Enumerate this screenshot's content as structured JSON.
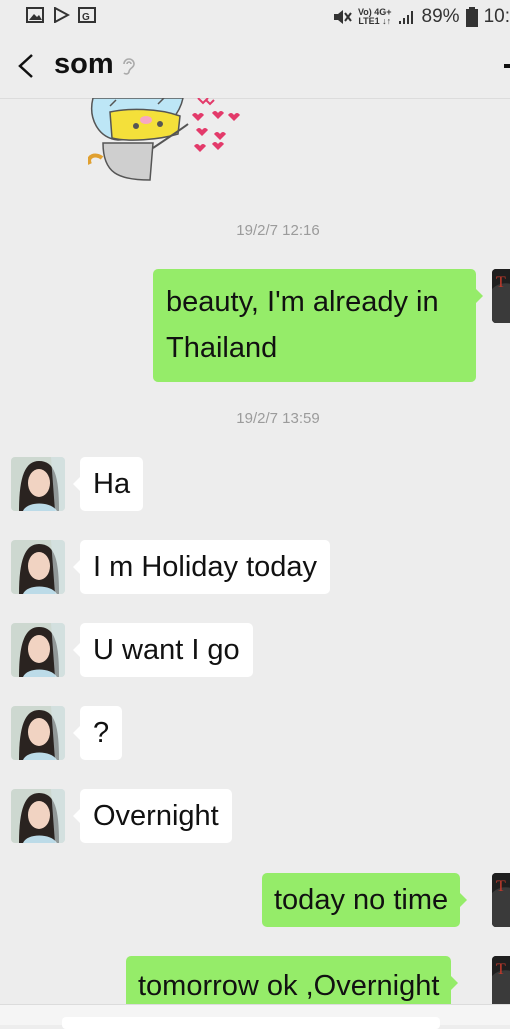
{
  "status_bar": {
    "network_label_top": "Vo) 4G+",
    "network_label_bottom": "LTE1 ↓↑",
    "battery": "89%",
    "clock": "10:"
  },
  "header": {
    "contact_name": "som",
    "icons": {
      "back": "chevron-left-icon",
      "mute": "ear-muted-icon",
      "more": "more-icon"
    }
  },
  "messages": [
    {
      "type": "sticker",
      "sender": "contact",
      "icon": "cat-sticker"
    },
    {
      "type": "time",
      "text": "19/2/7 12:16"
    },
    {
      "type": "text",
      "sender": "me",
      "lines": [
        "beauty, I'm already in",
        "Thailand"
      ]
    },
    {
      "type": "time",
      "text": "19/2/7 13:59"
    },
    {
      "type": "text",
      "sender": "contact",
      "text": "Ha"
    },
    {
      "type": "text",
      "sender": "contact",
      "text": "I m Holiday today"
    },
    {
      "type": "text",
      "sender": "contact",
      "text": "U want I go"
    },
    {
      "type": "text",
      "sender": "contact",
      "text": "?"
    },
    {
      "type": "text",
      "sender": "contact",
      "text": "Overnight"
    },
    {
      "type": "text",
      "sender": "me",
      "text": "today no time"
    },
    {
      "type": "text",
      "sender": "me",
      "text": "tomorrow ok ,Overnight"
    }
  ],
  "colors": {
    "background": "#ededed",
    "outgoing_bubble": "#95ec69",
    "incoming_bubble": "#ffffff",
    "timestamp": "#9b9b9b"
  }
}
